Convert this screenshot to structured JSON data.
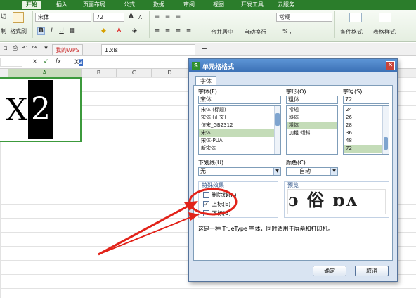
{
  "menu": {
    "tabs": [
      "开始",
      "插入",
      "页面布局",
      "公式",
      "数据",
      "审阅",
      "视图",
      "开发工具",
      "云服务"
    ],
    "active": "开始"
  },
  "ribbon": {
    "cut_label": "切",
    "copy_label": "制",
    "format_painter_label": "格式刷",
    "font_name": "宋体",
    "font_size": "72",
    "number_format": "常规",
    "merge_label": "合并居中",
    "wrap_label": "自动换行",
    "cond_format_label": "条件格式",
    "table_style_label": "表格样式",
    "percent_label": "% ,",
    "bold": "B",
    "italic": "I",
    "underline": "U",
    "grow_font": "A",
    "shrink_font": "A"
  },
  "tabbar": {
    "wps_tab": "我的WPS",
    "file_tab": "1.xls",
    "add": "+"
  },
  "formula_bar": {
    "x_symbol": "×",
    "check_symbol": "✓",
    "fx": "fx",
    "content_plain": "X",
    "content_selected": "2"
  },
  "grid": {
    "columns": [
      "A",
      "B",
      "C",
      "D"
    ],
    "cell_a1_base": "X",
    "cell_a1_super": "2"
  },
  "dialog": {
    "title": "单元格格式",
    "logo": "S",
    "tab": "字体",
    "font_label": "字体(F):",
    "font_value": "宋体",
    "font_list": [
      "宋体 (标题)",
      "宋体 (正文)",
      "仿宋_GB2312",
      "宋体",
      "宋体-PUA",
      "新宋体"
    ],
    "style_label": "字形(O):",
    "style_value": "粗体",
    "style_list": [
      "常规",
      "斜体",
      "粗体",
      "加粗 倾斜"
    ],
    "size_label": "字号(S):",
    "size_value": "72",
    "size_list": [
      "24",
      "26",
      "28",
      "36",
      "48",
      "72"
    ],
    "underline_label": "下划线(U):",
    "underline_value": "无",
    "color_label": "颜色(C):",
    "color_value": "自动",
    "effects_label": "特殊效果",
    "strike_label": "删除线(K)",
    "superscript_label": "上标(E)",
    "subscript_label": "下标(B)",
    "preview_label": "预览",
    "preview_text": "ɔ 俗    ɒʌ",
    "info_text": "这是一种 TrueType 字体，同时适用于屏幕和打印机。",
    "ok_label": "确定",
    "cancel_label": "取消"
  },
  "colors": {
    "menu_green": "#2b7d2b",
    "annotation_red": "#e2231a",
    "dialog_blue": "#3a6fb4"
  }
}
